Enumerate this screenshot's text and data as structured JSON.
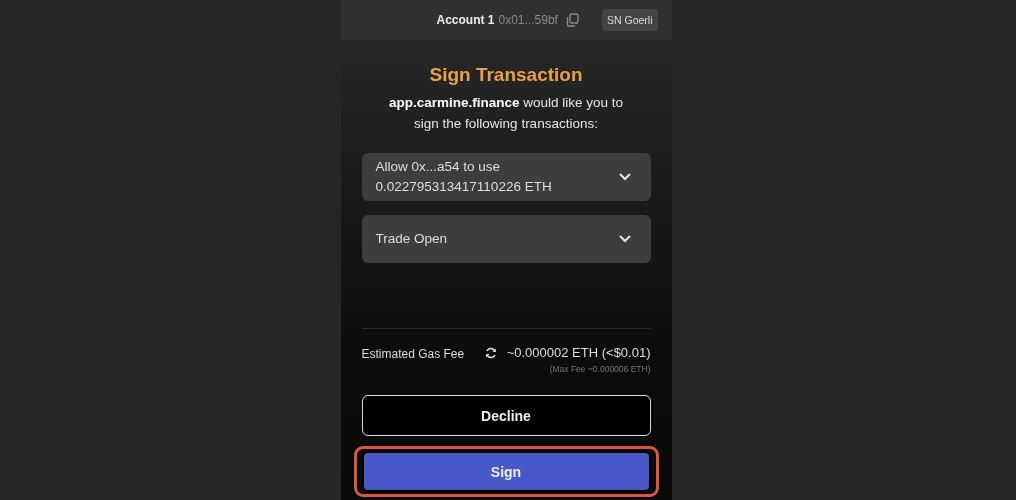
{
  "header": {
    "account_name": "Account 1",
    "address": "0x01...59bf",
    "network": "SN Goerli"
  },
  "title": "Sign Transaction",
  "description": "**app.carmine.finance** would like you to sign the following transactions:",
  "transactions": [
    {
      "label": "Allow 0x...a54 to use 0.022795313417110226 ETH",
      "expanded": false
    },
    {
      "label": "Trade Open",
      "expanded": false
    }
  ],
  "fee": {
    "label": "Estimated Gas Fee",
    "value": "~0.000002 ETH (<$0.01)",
    "max_fee": "(Max Fee ~0.000006 ETH)"
  },
  "buttons": [
    {
      "label": "Decline",
      "kind": "secondary",
      "highlighted": false
    },
    {
      "label": "Sign",
      "kind": "primary",
      "highlighted": true
    }
  ]
}
